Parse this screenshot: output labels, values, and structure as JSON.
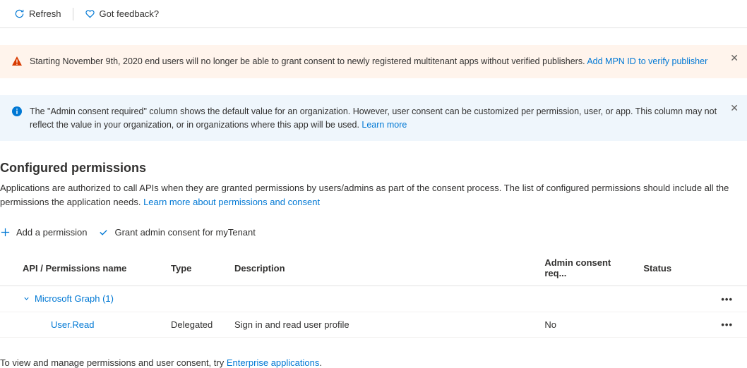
{
  "toolbar": {
    "refresh": "Refresh",
    "feedback": "Got feedback?"
  },
  "banners": {
    "warning": {
      "text": "Starting November 9th, 2020 end users will no longer be able to grant consent to newly registered multitenant apps without verified publishers. ",
      "linkText": "Add MPN ID to verify publisher"
    },
    "info": {
      "text": "The \"Admin consent required\" column shows the default value for an organization. However, user consent can be customized per permission, user, or app. This column may not reflect the value in your organization, or in organizations where this app will be used. ",
      "linkText": "Learn more"
    }
  },
  "section": {
    "title": "Configured permissions",
    "descPart1": "Applications are authorized to call APIs when they are granted permissions by users/admins as part of the consent process. The list of configured permissions should include all the permissions the application needs. ",
    "descLink": "Learn more about permissions and consent"
  },
  "actions": {
    "addPermission": "Add a permission",
    "grantConsent": "Grant admin consent for myTenant"
  },
  "table": {
    "headers": {
      "name": "API / Permissions name",
      "type": "Type",
      "description": "Description",
      "adminConsent": "Admin consent req...",
      "status": "Status"
    },
    "apiGroup": "Microsoft Graph (1)",
    "rows": [
      {
        "name": "User.Read",
        "type": "Delegated",
        "description": "Sign in and read user profile",
        "adminConsent": "No",
        "status": ""
      }
    ]
  },
  "footer": {
    "text": "To view and manage permissions and user consent, try ",
    "linkText": "Enterprise applications",
    "suffix": "."
  }
}
